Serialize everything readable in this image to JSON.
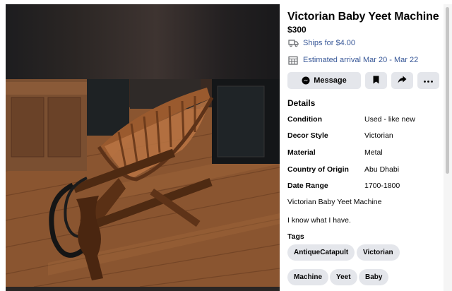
{
  "listing": {
    "title": "Victorian Baby Yeet Machine",
    "price": "$300",
    "shipping": "Ships for $4.00",
    "arrival": "Estimated arrival Mar 20 - Mar 22"
  },
  "actions": {
    "message_label": "Message",
    "icons": [
      "messenger-icon",
      "bookmark-icon",
      "share-icon",
      "more-icon"
    ]
  },
  "details": {
    "heading": "Details",
    "rows": [
      {
        "key": "Condition",
        "value": "Used - like new"
      },
      {
        "key": "Decor Style",
        "value": "Victorian"
      },
      {
        "key": "Material",
        "value": "Metal"
      },
      {
        "key": "Country of Origin",
        "value": "Abu Dhabi"
      },
      {
        "key": "Date Range",
        "value": "1700-1800"
      }
    ],
    "description": [
      "Victorian Baby Yeet Machine",
      "I know what I have."
    ]
  },
  "tags": {
    "heading": "Tags",
    "items": [
      "AntiqueCatapult",
      "Victorian",
      "Machine",
      "Yeet",
      "Baby"
    ]
  },
  "colors": {
    "link_blue": "#385898",
    "button_gray": "#e4e6eb",
    "text": "#050505"
  }
}
